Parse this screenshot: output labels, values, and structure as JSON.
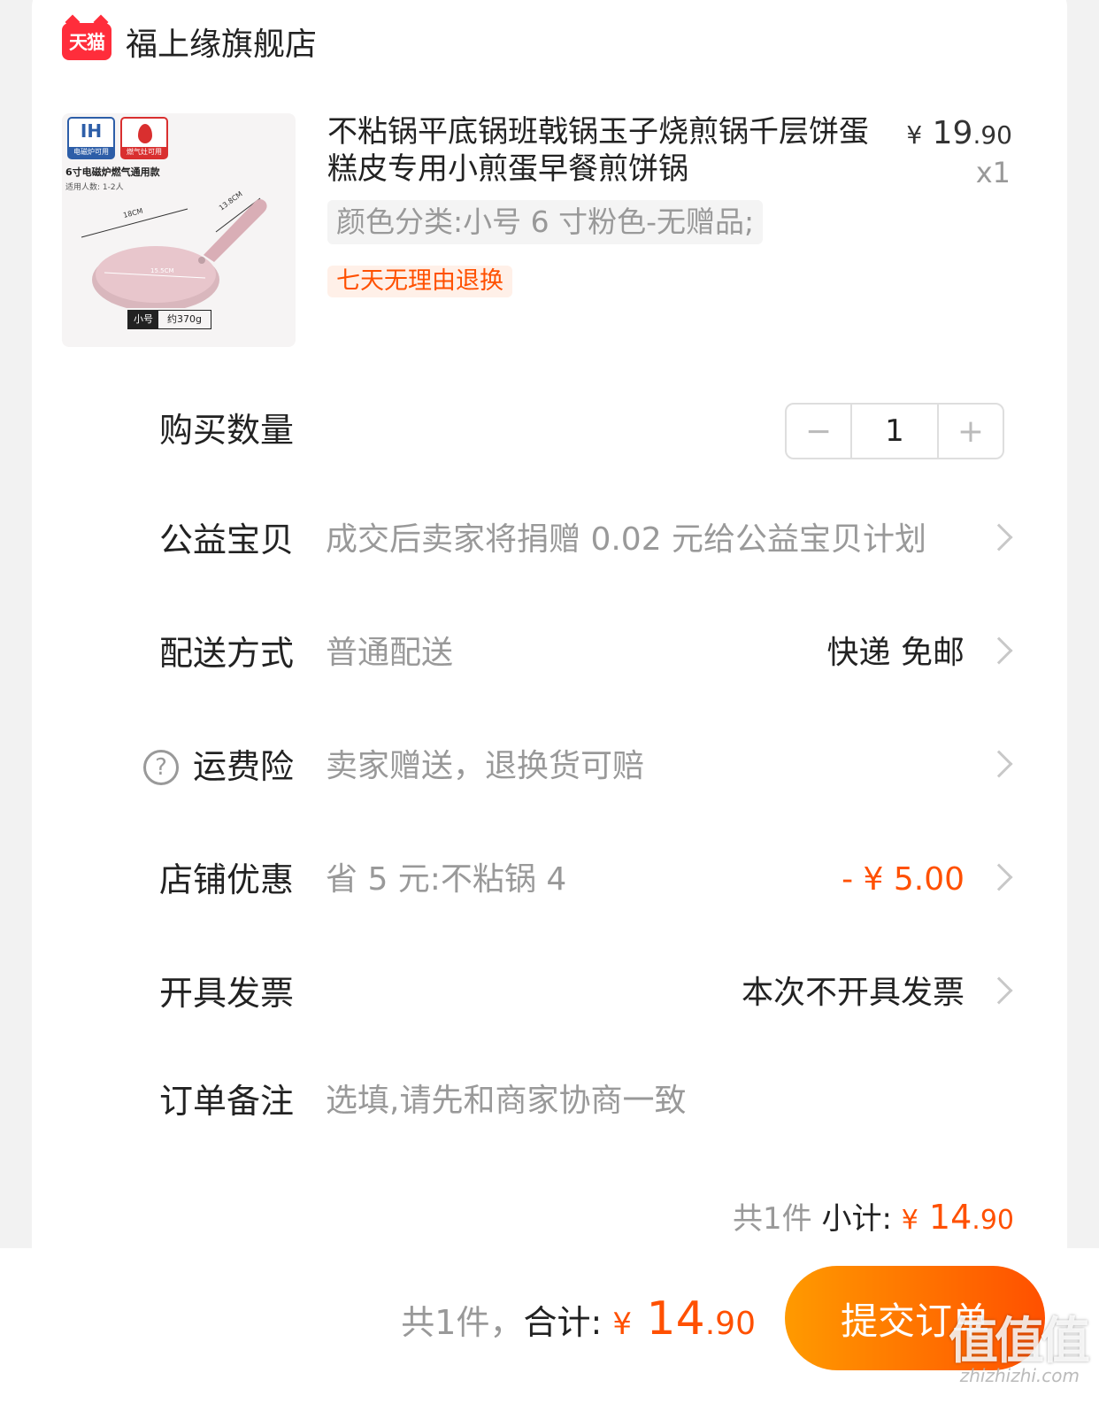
{
  "store": {
    "logo_text": "天猫",
    "name": "福上缘旗舰店"
  },
  "product": {
    "title": "不粘锅平底锅班戟锅玉子烧煎锅千层饼蛋糕皮专用小煎蛋早餐煎饼锅",
    "price_yen": "¥",
    "price_int": " 19",
    "price_dec": ".90",
    "quantity_x": "x1",
    "sku": "颜色分类:小号 6 寸粉色-无赠品;",
    "return_tag": "七天无理由退换",
    "thumb": {
      "badge_ih": "IH",
      "badge_ih_sub": "电磁炉可用",
      "badge_gas_sub": "燃气灶可用",
      "title": "6寸电磁炉燃气通用款",
      "sub": "适用人数: 1-2人",
      "dim_diameter": "18CM",
      "dim_handle": "13.8CM",
      "dim_inner": "15.5CM",
      "size_label": "小号",
      "weight": "约370g",
      "pan_color": "#e8c6cc"
    }
  },
  "rows": {
    "quantity": {
      "label": "购买数量",
      "value": "1",
      "minus": "−",
      "plus": "+"
    },
    "charity": {
      "label": "公益宝贝",
      "value": "成交后卖家将捐赠 0.02 元给公益宝贝计划"
    },
    "delivery": {
      "label": "配送方式",
      "value": "普通配送",
      "right": "快递 免邮"
    },
    "insurance": {
      "label": "运费险",
      "value": "卖家赠送，退换货可赔",
      "icon": "question-circle-icon"
    },
    "coupon": {
      "label": "店铺优惠",
      "value": "省 5 元:不粘锅 4",
      "right": "- ¥ 5.00"
    },
    "invoice": {
      "label": "开具发票",
      "right": "本次不开具发票"
    },
    "note": {
      "label": "订单备注",
      "placeholder": "选填,请先和商家协商一致"
    }
  },
  "subtotal": {
    "count": "共1件",
    "label": "小计:",
    "yen": "¥",
    "int": " 14",
    "dec": ".90"
  },
  "footer": {
    "count": "共1件，",
    "label": "合计:",
    "yen": "¥",
    "int": " 14",
    "dec": ".90",
    "submit": "提交订单",
    "watermark": "值值值",
    "watermark_url": "zhizhizhi.com"
  },
  "colors": {
    "accent": "#ff5000",
    "tmall_red": "#ff2d3b",
    "gradient_start": "#ff9a00"
  }
}
